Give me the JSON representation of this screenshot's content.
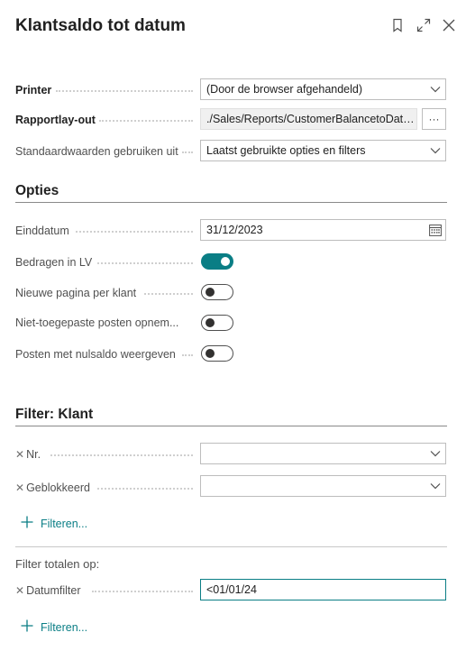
{
  "header": {
    "title": "Klantsaldo tot datum",
    "icons": [
      "bookmark-icon",
      "expand-icon",
      "close-icon"
    ]
  },
  "general": {
    "printer_label": "Printer",
    "printer_value": "(Door de browser afgehandeld)",
    "layout_label": "Rapportlay-out",
    "layout_value": "./Sales/Reports/CustomerBalancetoDate...",
    "layout_more": "···",
    "defaults_label": "Standaardwaarden gebruiken uit",
    "defaults_value": "Laatst gebruikte opties en filters"
  },
  "options": {
    "title": "Opties",
    "end_date_label": "Einddatum",
    "end_date_value": "31/12/2023",
    "amounts_lcy_label": "Bedragen in LV",
    "amounts_lcy_on": true,
    "new_page_label": "Nieuwe pagina per klant",
    "new_page_on": false,
    "unapplied_label": "Niet-toegepaste posten opnem...",
    "unapplied_on": false,
    "zero_balance_label": "Posten met nulsaldo weergeven",
    "zero_balance_on": false
  },
  "filter_customer": {
    "title": "Filter: Klant",
    "no_label": "Nr.",
    "no_value": "",
    "blocked_label": "Geblokkeerd",
    "blocked_value": "",
    "add_filter": "Filteren..."
  },
  "filter_totals": {
    "title": "Filter totalen op:",
    "date_filter_label": "Datumfilter",
    "date_filter_value": "<01/01/24",
    "add_filter": "Filteren..."
  },
  "colors": {
    "accent": "#0a7e85"
  }
}
